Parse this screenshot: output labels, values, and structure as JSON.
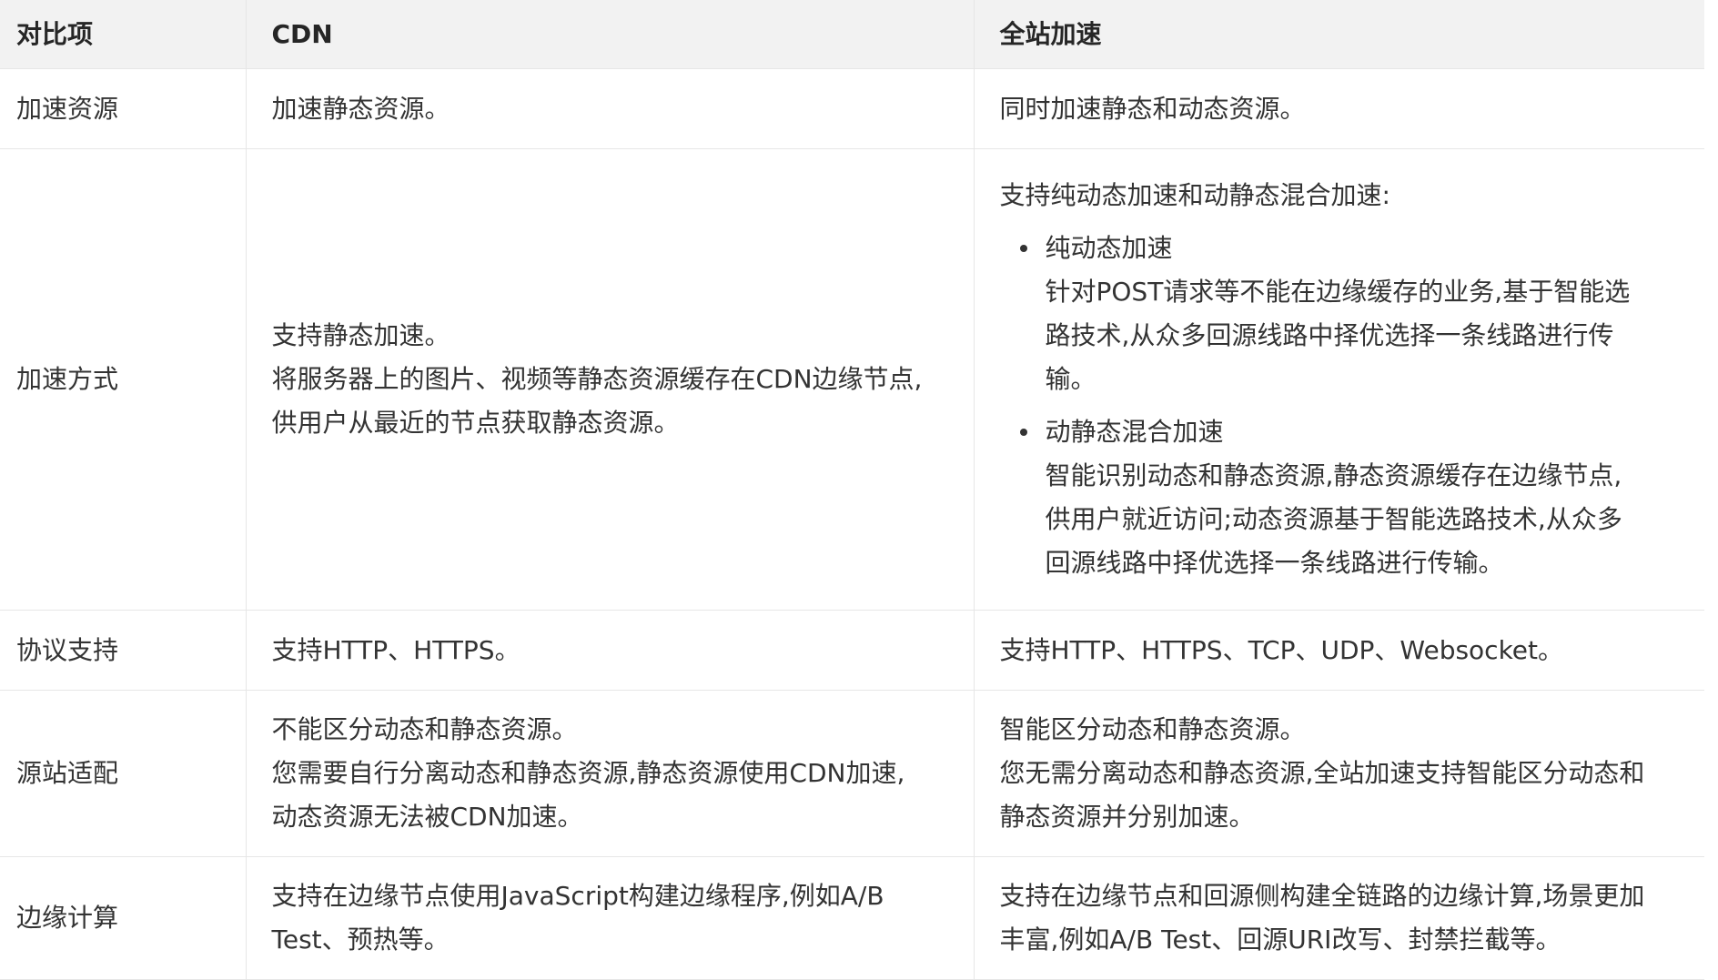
{
  "header": {
    "col1": "对比项",
    "col2": "CDN",
    "col3": "全站加速"
  },
  "rows": {
    "resources": {
      "label": "加速资源",
      "cdn": "加速静态资源。",
      "dcdn": "同时加速静态和动态资源。"
    },
    "method": {
      "label": "加速方式",
      "cdn": [
        "支持静态加速。",
        "将服务器上的图片、视频等静态资源缓存在CDN边缘节点,",
        "供用户从最近的节点获取静态资源。"
      ],
      "dcdn_intro": "支持纯动态加速和动静态混合加速:",
      "dcdn_bullets": [
        {
          "title": "纯动态加速",
          "lines": [
            "针对POST请求等不能在边缘缓存的业务,基于智能选",
            "路技术,从众多回源线路中择优选择一条线路进行传",
            "输。"
          ]
        },
        {
          "title": "动静态混合加速",
          "lines": [
            "智能识别动态和静态资源,静态资源缓存在边缘节点,",
            "供用户就近访问;动态资源基于智能选路技术,从众多",
            "回源线路中择优选择一条线路进行传输。"
          ]
        }
      ]
    },
    "protocol": {
      "label": "协议支持",
      "cdn": "支持HTTP、HTTPS。",
      "dcdn": "支持HTTP、HTTPS、TCP、UDP、Websocket。"
    },
    "origin": {
      "label": "源站适配",
      "cdn": [
        "不能区分动态和静态资源。",
        "您需要自行分离动态和静态资源,静态资源使用CDN加速,",
        "动态资源无法被CDN加速。"
      ],
      "dcdn": [
        "智能区分动态和静态资源。",
        "您无需分离动态和静态资源,全站加速支持智能区分动态和",
        "静态资源并分别加速。"
      ]
    },
    "edge": {
      "label": "边缘计算",
      "cdn": [
        "支持在边缘节点使用JavaScript构建边缘程序,例如A/B",
        "Test、预热等。"
      ],
      "dcdn": [
        "支持在边缘节点和回源侧构建全链路的边缘计算,场景更加",
        "丰富,例如A/B Test、回源URI改写、封禁拦截等。"
      ]
    }
  }
}
